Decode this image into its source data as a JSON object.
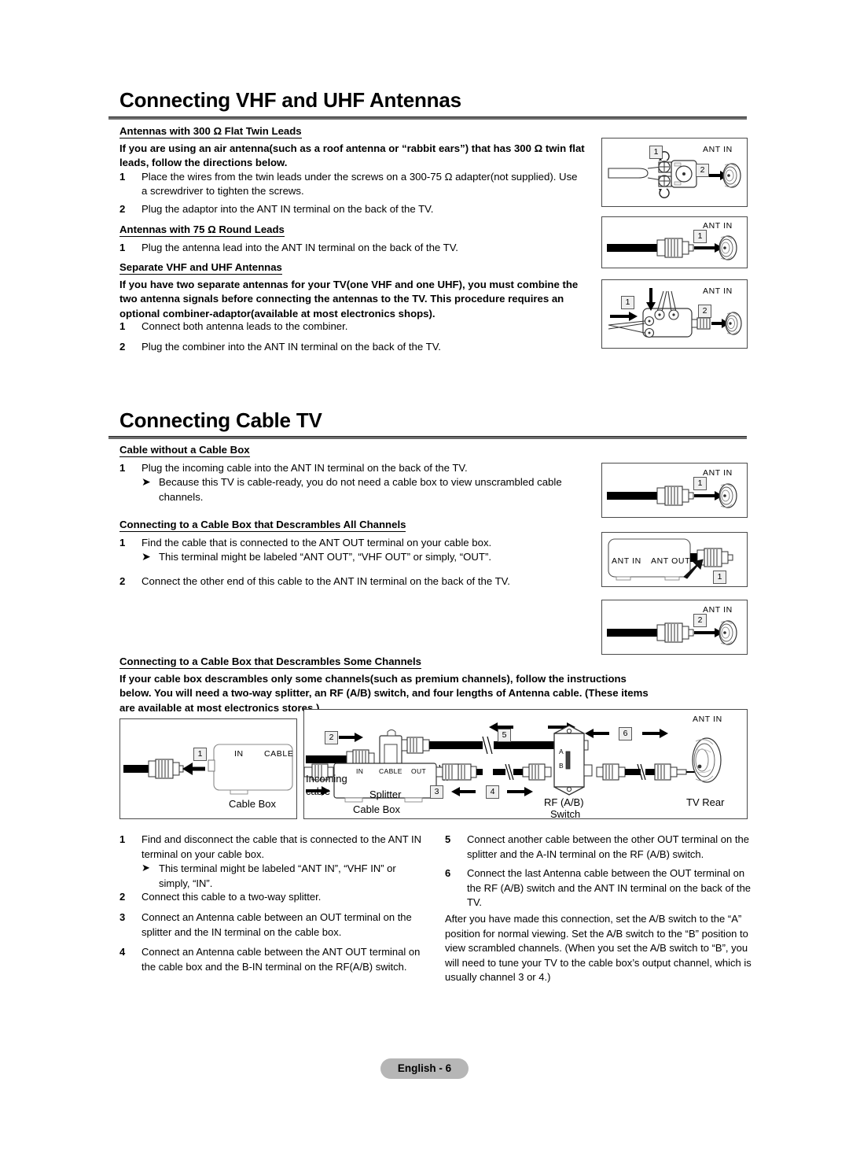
{
  "document": {
    "footer_label": "English - 6"
  },
  "section1": {
    "title": "Connecting VHF and UHF Antennas",
    "sub1": {
      "heading": "Antennas with 300 Ω Flat Twin Leads",
      "intro": "If you are using an air antenna(such as a roof antenna or “rabbit ears”) that has 300 Ω twin flat leads, follow the directions below.",
      "steps": [
        {
          "num": "1",
          "text": "Place the wires from the twin leads under the screws on a 300-75 Ω adapter(not supplied). Use a screwdriver to tighten the screws."
        },
        {
          "num": "2",
          "text": "Plug the adaptor into the ANT IN terminal on the back of the TV."
        }
      ]
    },
    "sub2": {
      "heading": "Antennas with 75 Ω Round Leads",
      "steps": [
        {
          "num": "1",
          "text": "Plug the antenna lead into the ANT IN terminal on the back of the TV."
        }
      ]
    },
    "sub3": {
      "heading": "Separate VHF and UHF Antennas",
      "intro": "If you have two separate antennas for your TV(one VHF and one UHF), you must combine the two antenna signals before connecting the antennas to the TV. This procedure requires an optional combiner-adaptor(available at most electronics shops).",
      "steps": [
        {
          "num": "1",
          "text": "Connect both antenna leads to the combiner."
        },
        {
          "num": "2",
          "text": "Plug the combiner into the ANT IN terminal on the back of the TV."
        }
      ]
    },
    "diagrams": {
      "d1": {
        "ant_in": "ANT IN",
        "chips": [
          "1",
          "2"
        ]
      },
      "d2": {
        "ant_in": "ANT IN",
        "chips": [
          "1"
        ]
      },
      "d3": {
        "ant_in": "ANT IN",
        "chips": [
          "1",
          "2"
        ]
      }
    }
  },
  "section2": {
    "title": "Connecting Cable TV",
    "sub1": {
      "heading": "Cable without a Cable Box",
      "steps": [
        {
          "num": "1",
          "text": "Plug the incoming cable into the ANT IN terminal on the back of the TV.",
          "note": "Because this TV is cable-ready, you do not need a cable box to view unscrambled cable channels."
        }
      ]
    },
    "sub2": {
      "heading": "Connecting to a Cable Box that Descrambles All Channels",
      "steps": [
        {
          "num": "1",
          "text": "Find the cable that is connected to the ANT OUT terminal on your cable box.",
          "note": "This terminal might be labeled “ANT OUT”, “VHF OUT” or simply, “OUT”."
        },
        {
          "num": "2",
          "text": "Connect the other end of this cable to the ANT IN terminal on the back of the TV."
        }
      ]
    },
    "sub3": {
      "heading": "Connecting to a Cable Box that Descrambles Some Channels",
      "intro": "If your cable box descrambles only some channels(such as premium channels), follow the instructions below. You will need a two-way splitter, an RF (A/B) switch, and four lengths of Antenna cable. (These items are available at most electronics stores.)"
    },
    "diagrams": {
      "d4": {
        "ant_in": "ANT IN",
        "chips": [
          "1"
        ]
      },
      "d5": {
        "ant_in": "ANT IN",
        "ant_out": "ANT OUT",
        "chips": [
          "1"
        ]
      },
      "d6": {
        "ant_in": "ANT IN",
        "chips": [
          "2"
        ]
      }
    }
  },
  "big_diagram": {
    "left": {
      "chip": "1",
      "label_in": "IN",
      "label_cable": "CABLE",
      "label_box": "Cable Box"
    },
    "right": {
      "chips": [
        "2",
        "3",
        "4",
        "5",
        "6"
      ],
      "label_incoming": "Incoming",
      "label_incoming2": "cable",
      "label_splitter": "Splitter",
      "label_in": "IN",
      "label_cable": "CABLE",
      "label_out": "OUT",
      "label_cable_box": "Cable Box",
      "label_rf": "RF (A/B)",
      "label_switch": "Switch",
      "label_switch_a": "A",
      "label_switch_b": "B",
      "label_tv_rear": "TV Rear",
      "label_ant_in": "ANT IN"
    }
  },
  "bottom_steps": {
    "left": [
      {
        "num": "1",
        "text": "Find and disconnect the cable that is connected to the ANT IN terminal on your cable box.",
        "note": "This terminal might be labeled “ANT IN”, “VHF IN” or simply, “IN”."
      },
      {
        "num": "2",
        "text": "Connect this cable to a two-way splitter."
      },
      {
        "num": "3",
        "text": "Connect an Antenna cable between an OUT terminal on the splitter and the IN terminal on the cable box."
      },
      {
        "num": "4",
        "text": "Connect an Antenna cable between the ANT OUT terminal on the cable box and the B-IN terminal on the RF(A/B) switch."
      }
    ],
    "right": [
      {
        "num": "5",
        "text": "Connect another cable between the other OUT terminal on the splitter and the A-IN terminal on the RF (A/B) switch."
      },
      {
        "num": "6",
        "text": "Connect the last Antenna cable between the OUT terminal on the RF (A/B) switch and the ANT IN terminal on the back of the TV."
      }
    ],
    "closing": "After you have made this connection, set the A/B switch to the “A” position for normal viewing. Set the A/B switch to the “B” position to view scrambled channels. (When you set the A/B switch to “B”, you will need to tune your TV to the cable box’s output channel, which is usually channel 3 or 4.)"
  },
  "icons": {
    "bullet_arrow": "➤"
  },
  "colors": {
    "rule": "#6d6d6d",
    "chip_bg": "#efefef",
    "frame": "#4a4a4a",
    "footer_bg": "#b6b6b6"
  }
}
